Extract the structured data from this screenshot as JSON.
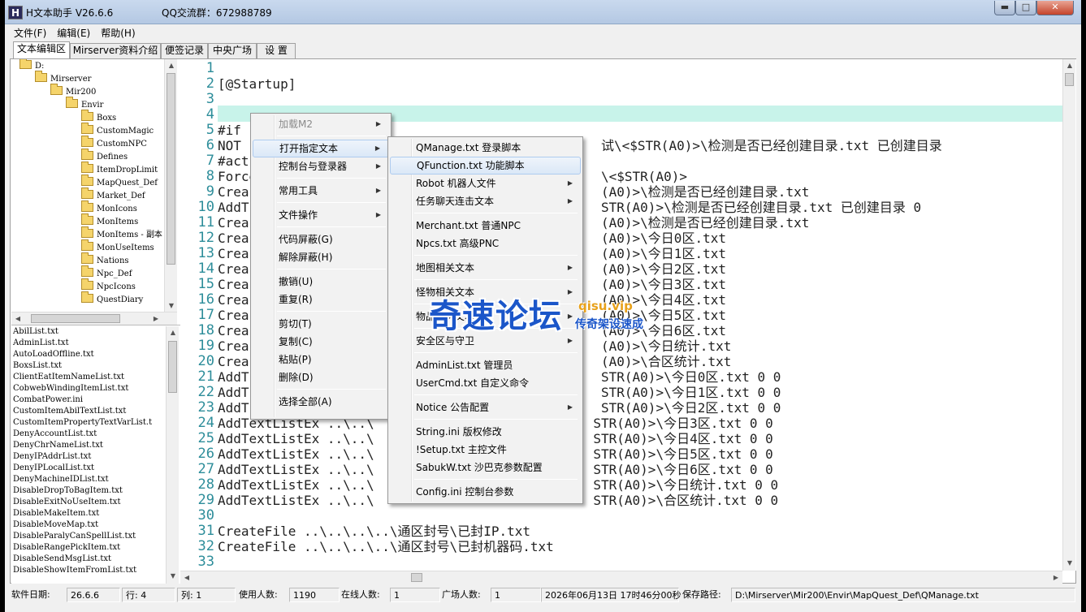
{
  "window": {
    "title": "H文本助手  V26.6.6",
    "qq_group": "QQ交流群：672988789",
    "minimize": "▬",
    "maximize": "□",
    "close": "✕"
  },
  "menubar": [
    "文件(F)",
    "编辑(E)",
    "帮助(H)"
  ],
  "tabs": [
    "文本编辑区",
    "Mirserver资料介绍",
    "便签记录",
    "中央广场",
    "设  置"
  ],
  "tree": [
    {
      "label": "D:",
      "level": 0
    },
    {
      "label": "Mirserver",
      "level": 1
    },
    {
      "label": "Mir200",
      "level": 2
    },
    {
      "label": "Envir",
      "level": 3
    },
    {
      "label": "Boxs",
      "level": 4
    },
    {
      "label": "CustomMagic",
      "level": 4
    },
    {
      "label": "CustomNPC",
      "level": 4
    },
    {
      "label": "Defines",
      "level": 4
    },
    {
      "label": "ItemDropLimit",
      "level": 4
    },
    {
      "label": "MapQuest_Def",
      "level": 4
    },
    {
      "label": "Market_Def",
      "level": 4
    },
    {
      "label": "MonIcons",
      "level": 4
    },
    {
      "label": "MonItems",
      "level": 4
    },
    {
      "label": "MonItems - 副本",
      "level": 4
    },
    {
      "label": "MonUseItems",
      "level": 4
    },
    {
      "label": "Nations",
      "level": 4
    },
    {
      "label": "Npc_Def",
      "level": 4
    },
    {
      "label": "NpcIcons",
      "level": 4
    },
    {
      "label": "QuestDiary",
      "level": 4
    }
  ],
  "files": [
    "AbilList.txt",
    "AdminList.txt",
    "AutoLoadOffline.txt",
    "BoxsList.txt",
    "ClientEatItemNameList.txt",
    "CobwebWindingItemList.txt",
    "CombatPower.ini",
    "CustomItemAbilTextList.txt",
    "CustomItemPropertyTextVarList.t",
    "DenyAccountList.txt",
    "DenyChrNameList.txt",
    "DenyIPAddrList.txt",
    "DenyIPLocalList.txt",
    "DenyMachineIDList.txt",
    "DisableDropToBagItem.txt",
    "DisableExitNoUseItem.txt",
    "DisableMakeItem.txt",
    "DisableMoveMap.txt",
    "DisableParalyCanSpellList.txt",
    "DisableRangePickItem.txt",
    "DisableSendMsgList.txt",
    "DisableShowItemFromList.txt"
  ],
  "editor": {
    "lines": [
      {
        "n": "1",
        "t": ""
      },
      {
        "n": "2",
        "t": "[@Startup]"
      },
      {
        "n": "3",
        "t": ""
      },
      {
        "n": "4",
        "t": ""
      },
      {
        "n": "5",
        "t": "#if"
      },
      {
        "n": "6",
        "t": "NOT                                              试\\<$STR(A0)>\\检测是否已经创建目录.txt 已创建目录"
      },
      {
        "n": "7",
        "t": "#act"
      },
      {
        "n": "8",
        "t": "Force                                            \\<$STR(A0)>"
      },
      {
        "n": "9",
        "t": "Crea                                             (A0)>\\检测是否已经创建目录.txt"
      },
      {
        "n": "10",
        "t": "AddT                                             STR(A0)>\\检测是否已经创建目录.txt 已创建目录 0"
      },
      {
        "n": "11",
        "t": "Crea                                             (A0)>\\检测是否已经创建目录.txt"
      },
      {
        "n": "12",
        "t": "Crea                                             (A0)>\\今日0区.txt"
      },
      {
        "n": "13",
        "t": "Crea                                             (A0)>\\今日1区.txt"
      },
      {
        "n": "14",
        "t": "Crea                                             (A0)>\\今日2区.txt"
      },
      {
        "n": "15",
        "t": "Crea                                             (A0)>\\今日3区.txt"
      },
      {
        "n": "16",
        "t": "Crea                                             (A0)>\\今日4区.txt"
      },
      {
        "n": "17",
        "t": "Crea                                             (A0)>\\今日5区.txt"
      },
      {
        "n": "18",
        "t": "Crea                                             (A0)>\\今日6区.txt"
      },
      {
        "n": "19",
        "t": "Crea                                             (A0)>\\今日统计.txt"
      },
      {
        "n": "20",
        "t": "Crea                                             (A0)>\\合区统计.txt"
      },
      {
        "n": "21",
        "t": "AddT                                             STR(A0)>\\今日0区.txt 0 0"
      },
      {
        "n": "22",
        "t": "AddT                                             STR(A0)>\\今日1区.txt 0 0"
      },
      {
        "n": "23",
        "t": "AddT                                             STR(A0)>\\今日2区.txt 0 0"
      },
      {
        "n": "24",
        "t": "AddTextListEx ..\\..\\                            STR(A0)>\\今日3区.txt 0 0"
      },
      {
        "n": "25",
        "t": "AddTextListEx ..\\..\\                            STR(A0)>\\今日4区.txt 0 0"
      },
      {
        "n": "26",
        "t": "AddTextListEx ..\\..\\                            STR(A0)>\\今日5区.txt 0 0"
      },
      {
        "n": "27",
        "t": "AddTextListEx ..\\..\\                            STR(A0)>\\今日6区.txt 0 0"
      },
      {
        "n": "28",
        "t": "AddTextListEx ..\\..\\                            STR(A0)>\\今日统计.txt 0 0"
      },
      {
        "n": "29",
        "t": "AddTextListEx ..\\..\\                            STR(A0)>\\合区统计.txt 0 0"
      },
      {
        "n": "30",
        "t": ""
      },
      {
        "n": "31",
        "t": "CreateFile ..\\..\\..\\..\\通区封号\\已封IP.txt"
      },
      {
        "n": "32",
        "t": "CreateFile ..\\..\\..\\..\\通区封号\\已封机器码.txt"
      },
      {
        "n": "33",
        "t": ""
      }
    ]
  },
  "context_menu": [
    {
      "label": "加载M2",
      "sub": true,
      "disabled": true,
      "sep_after": true
    },
    {
      "label": "打开指定文本",
      "sub": true,
      "hover": true
    },
    {
      "label": "控制台与登录器",
      "sub": true,
      "sep_after": true
    },
    {
      "label": "常用工具",
      "sub": true,
      "sep_after": true
    },
    {
      "label": "文件操作",
      "sub": true,
      "sep_after": true
    },
    {
      "label": "代码屏蔽(G)",
      "sub": false
    },
    {
      "label": "解除屏蔽(H)",
      "sub": false,
      "sep_after": true
    },
    {
      "label": "撤销(U)",
      "sub": false
    },
    {
      "label": "重复(R)",
      "sub": false,
      "sep_after": true
    },
    {
      "label": "剪切(T)",
      "sub": false
    },
    {
      "label": "复制(C)",
      "sub": false
    },
    {
      "label": "粘贴(P)",
      "sub": false
    },
    {
      "label": "删除(D)",
      "sub": false,
      "sep_after": true
    },
    {
      "label": "选择全部(A)",
      "sub": false
    }
  ],
  "submenu": [
    {
      "label": "QManage.txt 登录脚本",
      "sub": false
    },
    {
      "label": "QFunction.txt 功能脚本",
      "sub": false,
      "hover": true
    },
    {
      "label": "Robot 机器人文件",
      "sub": true
    },
    {
      "label": "任务聊天连击文本",
      "sub": true,
      "sep_after": true
    },
    {
      "label": "Merchant.txt 普通NPC",
      "sub": false
    },
    {
      "label": "Npcs.txt 高级PNC",
      "sub": false,
      "sep_after": true
    },
    {
      "label": "地图相关文本",
      "sub": true,
      "sep_after": true
    },
    {
      "label": "怪物相关文本",
      "sub": true,
      "sep_after": true
    },
    {
      "label": "物品相关文本",
      "sub": true,
      "sep_after": true
    },
    {
      "label": "安全区与守卫",
      "sub": true,
      "sep_after": true
    },
    {
      "label": "AdminList.txt 管理员",
      "sub": false
    },
    {
      "label": "UserCmd.txt 自定义命令",
      "sub": false,
      "sep_after": true
    },
    {
      "label": "Notice 公告配置",
      "sub": true,
      "sep_after": true
    },
    {
      "label": "String.ini 版权修改",
      "sub": false
    },
    {
      "label": "!Setup.txt 主控文件",
      "sub": false
    },
    {
      "label": "SabukW.txt 沙巴克参数配置",
      "sub": false,
      "sep_after": true
    },
    {
      "label": "Config.ini 控制台参数",
      "sub": false
    }
  ],
  "watermark": {
    "main": "奇速论坛",
    "url": "qisu.vip",
    "sub": "传奇架设速成"
  },
  "statusbar": {
    "version_label": "软件日期:",
    "version_value": "26.6.6",
    "row_label": "行: 4",
    "col_label": "列: 1",
    "users_label": "使用人数:",
    "users_value": "1190",
    "online_label": "在线人数:",
    "online_value": "1",
    "plaza_label": "广场人数:",
    "plaza_value": "1",
    "datetime": "2026年06月13日 17时46分00秒",
    "save_label": "保存路径:",
    "save_path": "D:\\Mirserver\\Mir200\\Envir\\MapQuest_Def\\QManage.txt"
  }
}
